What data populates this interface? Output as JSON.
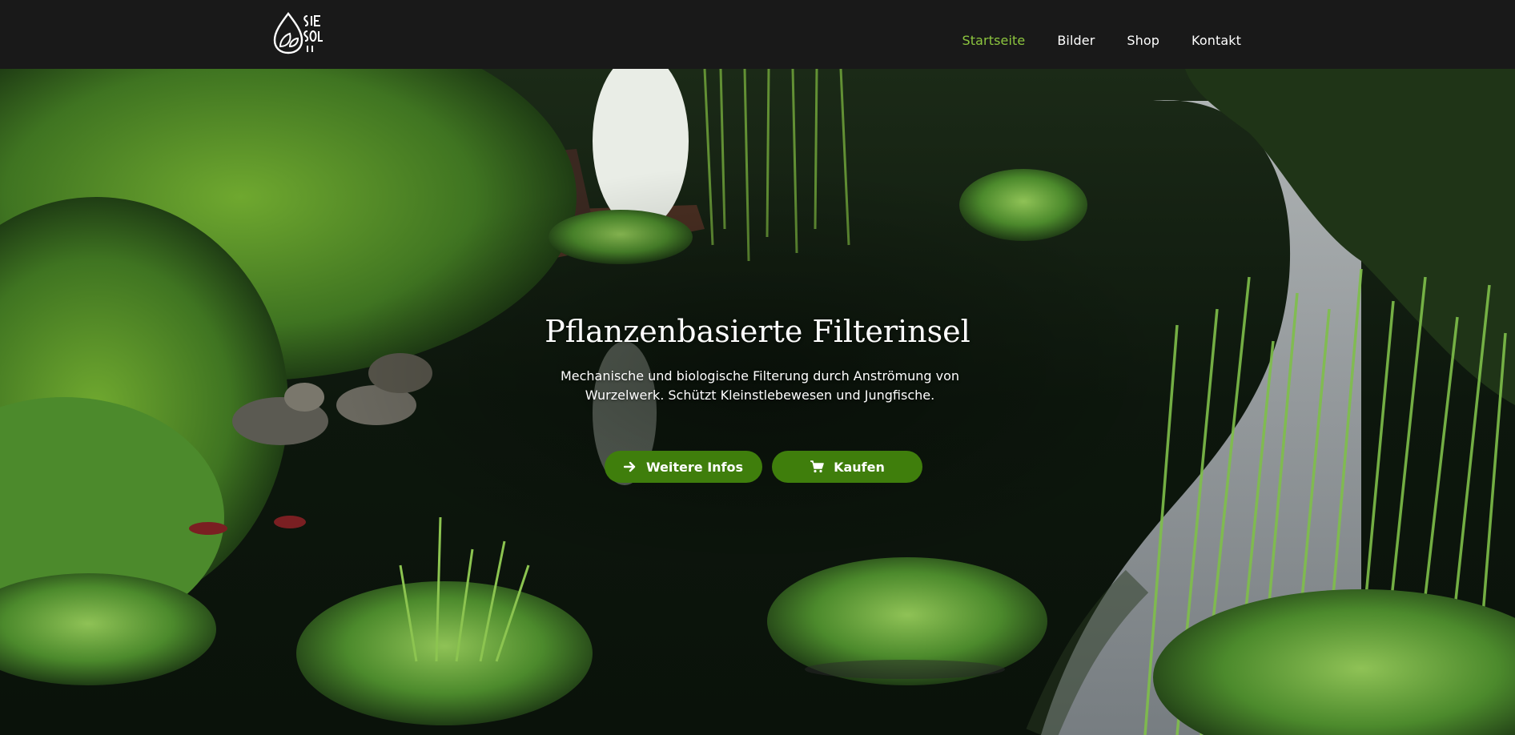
{
  "header": {
    "logo_text": "SIE SOL",
    "nav": [
      {
        "label": "Startseite",
        "active": true
      },
      {
        "label": "Bilder",
        "active": false
      },
      {
        "label": "Shop",
        "active": false
      },
      {
        "label": "Kontakt",
        "active": false
      }
    ]
  },
  "hero": {
    "title": "Pflanzenbasierte Filterinsel",
    "subtitle": "Mechanische und biologische Filterung durch Anströmung von Wurzelwerk. Schützt Kleinstlebewesen und Jungfische.",
    "buttons": {
      "info": {
        "label": "Weitere Infos",
        "icon": "arrow-right-icon"
      },
      "buy": {
        "label": "Kaufen",
        "icon": "shopping-cart-icon"
      }
    }
  },
  "colors": {
    "header_bg": "#191919",
    "nav_active": "#8dc63f",
    "button_bg": "#3f7e0c",
    "text": "#ffffff"
  }
}
